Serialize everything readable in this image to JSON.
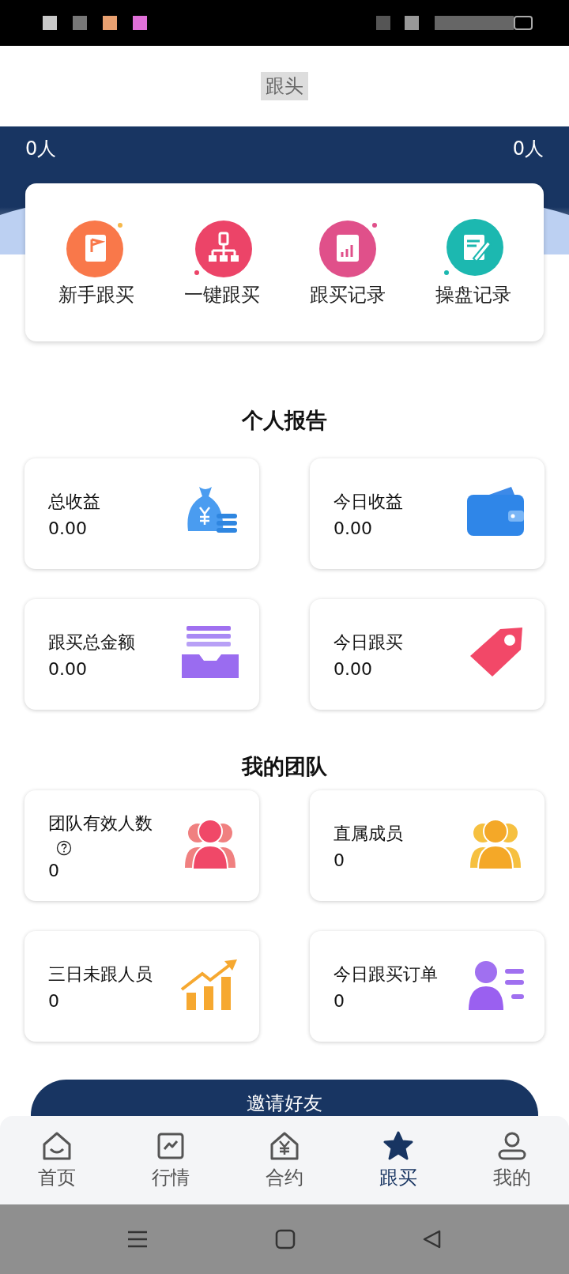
{
  "header": {
    "title": "跟头"
  },
  "banner": {
    "left_count": "0人",
    "right_count": "0人"
  },
  "quick_actions": [
    {
      "kind": "notebook",
      "label": "新手跟买"
    },
    {
      "kind": "org",
      "label": "一键跟买"
    },
    {
      "kind": "record",
      "label": "跟买记录"
    },
    {
      "kind": "edit",
      "label": "操盘记录"
    }
  ],
  "personal_report": {
    "heading": "个人报告",
    "cards": [
      {
        "kind": "moneybag",
        "label": "总收益",
        "value": "0.00",
        "help": false
      },
      {
        "kind": "wallet",
        "label": "今日收益",
        "value": "0.00",
        "help": false
      },
      {
        "kind": "tray",
        "label": "跟买总金额",
        "value": "0.00",
        "help": false
      },
      {
        "kind": "tag",
        "label": "今日跟买",
        "value": "0.00",
        "help": false
      }
    ]
  },
  "my_team": {
    "heading": "我的团队",
    "cards": [
      {
        "kind": "group-red",
        "label": "团队有效人数",
        "value": "0",
        "help": true
      },
      {
        "kind": "group-yellow",
        "label": "直属成员",
        "value": "0",
        "help": false
      },
      {
        "kind": "growth",
        "label": "三日未跟人员",
        "value": "0",
        "help": false
      },
      {
        "kind": "person-list",
        "label": "今日跟买订单",
        "value": "0",
        "help": false
      }
    ]
  },
  "invite_button": {
    "label": "邀请好友"
  },
  "tabs": [
    {
      "kind": "home",
      "label": "首页",
      "selected": false
    },
    {
      "kind": "chart",
      "label": "行情",
      "selected": false
    },
    {
      "kind": "contract",
      "label": "合约",
      "selected": false
    },
    {
      "kind": "star",
      "label": "跟买",
      "selected": true
    },
    {
      "kind": "user",
      "label": "我的",
      "selected": false
    }
  ]
}
